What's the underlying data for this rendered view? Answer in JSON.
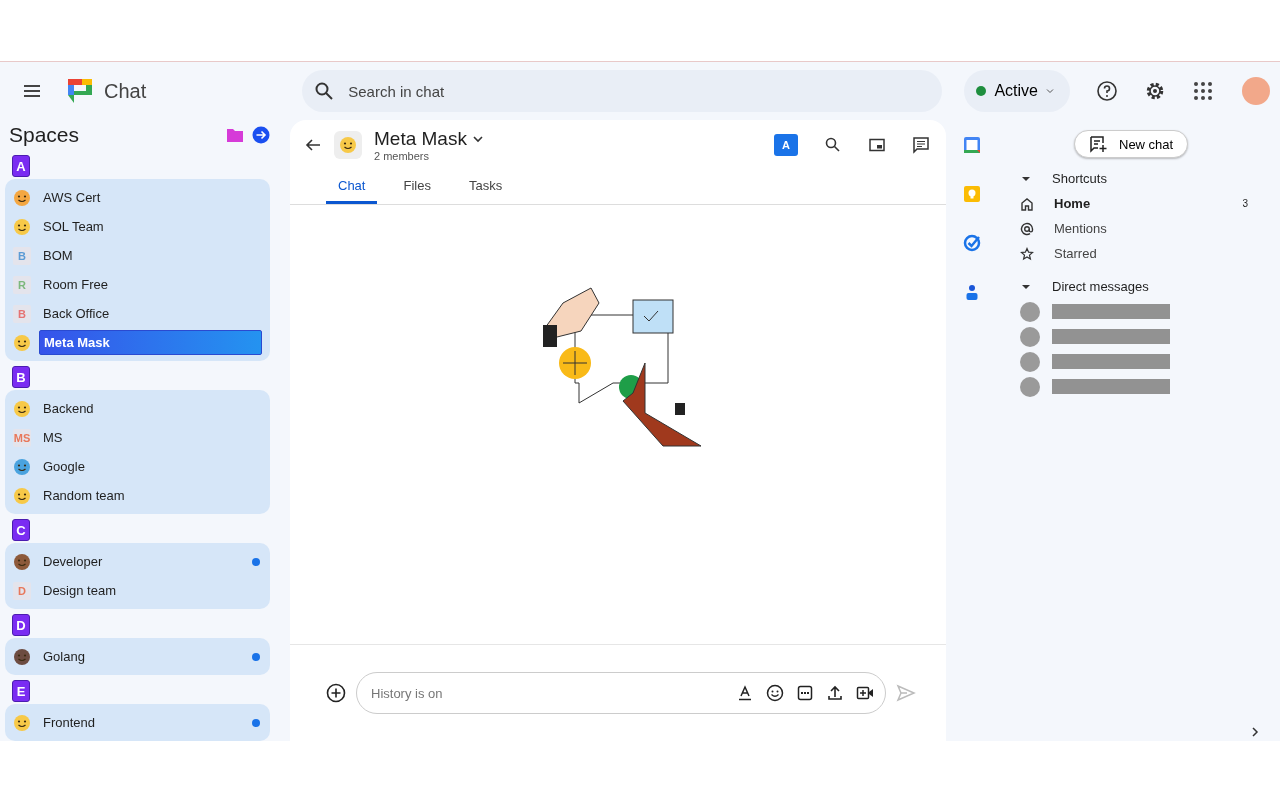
{
  "app": {
    "name": "Chat"
  },
  "search": {
    "placeholder": "Search in chat"
  },
  "status": {
    "label": "Active",
    "color": "#1e8e3e"
  },
  "spaces": {
    "title": "Spaces",
    "groups": [
      {
        "badge": "A",
        "items": [
          {
            "name": "AWS Cert",
            "kind": "emoji",
            "color": "#f4a742",
            "selected": false,
            "unread": false
          },
          {
            "name": "SOL Team",
            "kind": "emoji",
            "color": "#f7c948",
            "selected": false,
            "unread": false
          },
          {
            "name": "BOM",
            "kind": "letter",
            "avatar_text": "B",
            "color": "#5b9bd5",
            "selected": false,
            "unread": false
          },
          {
            "name": "Room Free",
            "kind": "letter",
            "avatar_text": "R",
            "color": "#7cb87c",
            "selected": false,
            "unread": false
          },
          {
            "name": "Back Office",
            "kind": "letter",
            "avatar_text": "B",
            "color": "#e57373",
            "selected": false,
            "unread": false
          },
          {
            "name": "Meta Mask",
            "kind": "emoji",
            "color": "#f7c948",
            "selected": true,
            "unread": false
          }
        ]
      },
      {
        "badge": "B",
        "items": [
          {
            "name": "Backend",
            "kind": "emoji",
            "color": "#f7c948",
            "selected": false,
            "unread": false
          },
          {
            "name": "MS",
            "kind": "letter",
            "avatar_text": "MS",
            "color": "#e8775a",
            "selected": false,
            "unread": false
          },
          {
            "name": "Google",
            "kind": "emoji",
            "color": "#4aa3df",
            "selected": false,
            "unread": false
          },
          {
            "name": "Random team",
            "kind": "emoji",
            "color": "#f7c948",
            "selected": false,
            "unread": false
          }
        ]
      },
      {
        "badge": "C",
        "items": [
          {
            "name": "Developer",
            "kind": "emoji",
            "color": "#8d5a3b",
            "selected": false,
            "unread": true
          },
          {
            "name": "Design team",
            "kind": "letter",
            "avatar_text": "D",
            "color": "#e8775a",
            "selected": false,
            "unread": false
          }
        ]
      },
      {
        "badge": "D",
        "items": [
          {
            "name": "Golang",
            "kind": "emoji",
            "color": "#6d4c41",
            "selected": false,
            "unread": true
          }
        ]
      },
      {
        "badge": "E",
        "items": [
          {
            "name": "Frontend",
            "kind": "emoji",
            "color": "#f7c948",
            "selected": false,
            "unread": true
          }
        ]
      }
    ]
  },
  "conversation": {
    "title": "Meta Mask",
    "subtitle": "2 members",
    "badge": "A",
    "tabs": [
      {
        "label": "Chat",
        "selected": true
      },
      {
        "label": "Files",
        "selected": false
      },
      {
        "label": "Tasks",
        "selected": false
      }
    ],
    "composer": {
      "placeholder": "History is on"
    }
  },
  "right_panel": {
    "new_chat": "New chat",
    "shortcuts": {
      "title": "Shortcuts",
      "expanded": true,
      "items": [
        {
          "label": "Home",
          "selected": true,
          "count": "3"
        },
        {
          "label": "Mentions",
          "selected": false
        },
        {
          "label": "Starred",
          "selected": false
        }
      ]
    },
    "direct_messages": {
      "title": "Direct messages",
      "expanded": true
    }
  }
}
